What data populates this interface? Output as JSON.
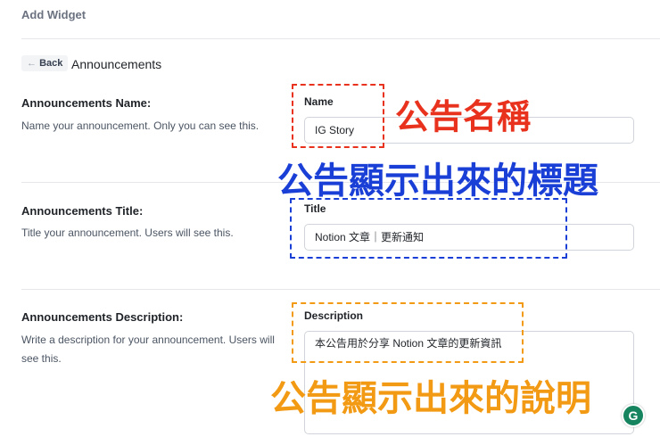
{
  "header": {
    "title": "Add Widget"
  },
  "nav": {
    "back_label": "Back",
    "page_title": "Announcements"
  },
  "sections": [
    {
      "heading": "Announcements Name:",
      "description": "Name your announcement. Only you can see this.",
      "field_label": "Name",
      "value": "IG Story"
    },
    {
      "heading": "Announcements Title:",
      "description": "Title your announcement. Users will see this.",
      "field_label": "Title",
      "value": "Notion 文章｜更新通知"
    },
    {
      "heading": "Announcements Description:",
      "description": "Write a description for your announcement. Users will see this.",
      "field_label": "Description",
      "value": "本公告用於分享 Notion 文章的更新資訊"
    }
  ],
  "annotations": {
    "name": "公告名稱",
    "title": "公告顯示出來的標題",
    "description": "公告顯示出來的說明"
  },
  "colors": {
    "red": "#e8321e",
    "blue": "#1a3fd6",
    "orange": "#f39a14"
  },
  "grammarly": "G"
}
